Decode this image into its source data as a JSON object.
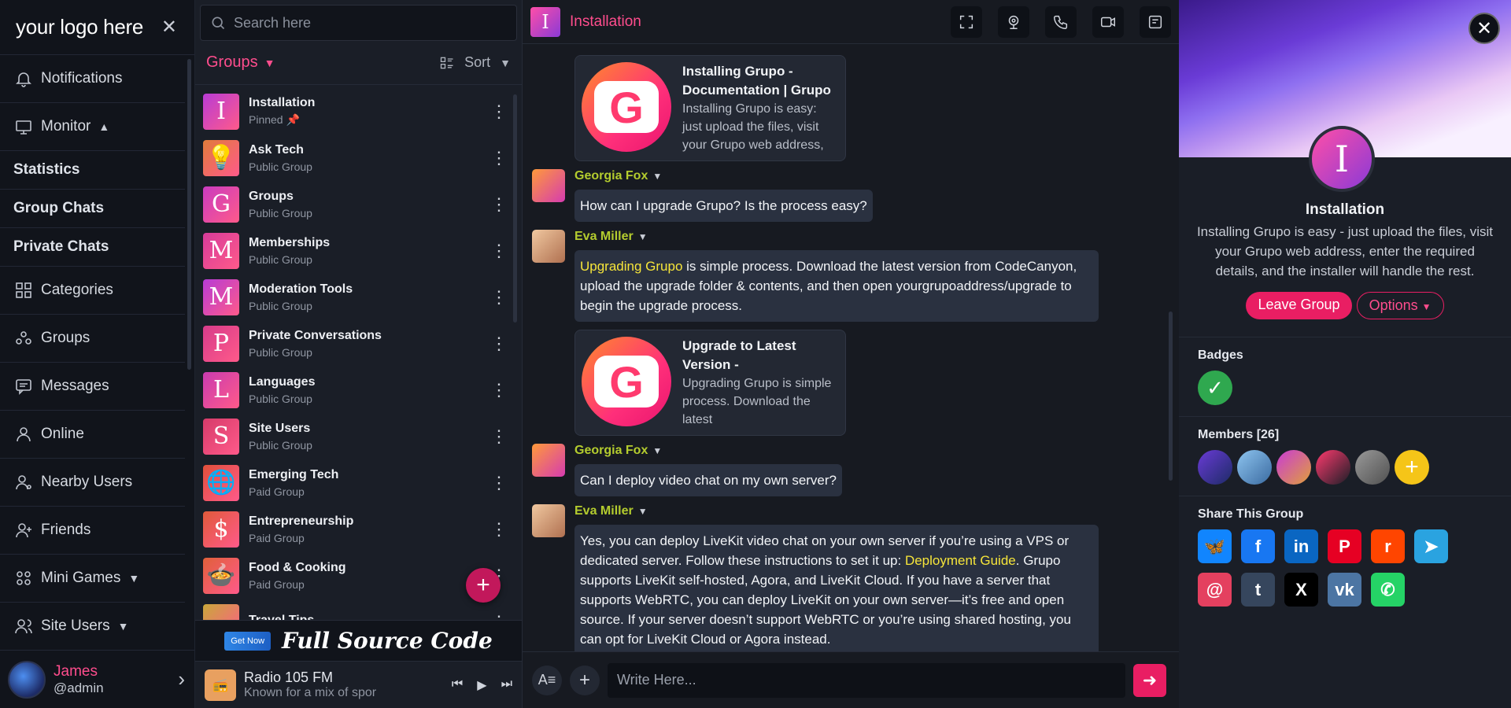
{
  "nav": {
    "logo": "your logo here",
    "items": [
      {
        "label": "Notifications",
        "icon": "bell-icon",
        "type": "main"
      },
      {
        "label": "Monitor",
        "icon": "monitor-icon",
        "type": "main",
        "chevron": "up"
      },
      {
        "label": "Statistics",
        "type": "sub"
      },
      {
        "label": "Group Chats",
        "type": "sub"
      },
      {
        "label": "Private Chats",
        "type": "sub"
      },
      {
        "label": "Categories",
        "icon": "grid-icon",
        "type": "main"
      },
      {
        "label": "Groups",
        "icon": "groups-icon",
        "type": "main"
      },
      {
        "label": "Messages",
        "icon": "message-icon",
        "type": "main"
      },
      {
        "label": "Online",
        "icon": "user-icon",
        "type": "main"
      },
      {
        "label": "Nearby Users",
        "icon": "nearby-icon",
        "type": "main"
      },
      {
        "label": "Friends",
        "icon": "add-user-icon",
        "type": "main"
      },
      {
        "label": "Mini Games",
        "icon": "games-icon",
        "type": "main",
        "chevron": "down"
      },
      {
        "label": "Site Users",
        "icon": "users-icon",
        "type": "main",
        "chevron": "down"
      }
    ],
    "user": {
      "name": "James",
      "handle": "@admin"
    }
  },
  "grouplist": {
    "search_placeholder": "Search here",
    "title": "Groups",
    "sort": "Sort",
    "items": [
      {
        "name": "Installation",
        "sub": "Pinned",
        "letter": "I",
        "color": "#b83bd6",
        "pinned": true
      },
      {
        "name": "Ask Tech",
        "sub": "Public Group",
        "letter": "💡",
        "color": "#e07c3a"
      },
      {
        "name": "Groups",
        "sub": "Public Group",
        "letter": "G",
        "color": "#c93bc0"
      },
      {
        "name": "Memberships",
        "sub": "Public Group",
        "letter": "M",
        "color": "#d63b9a"
      },
      {
        "name": "Moderation Tools",
        "sub": "Public Group",
        "letter": "M",
        "color": "#b63bd6"
      },
      {
        "name": "Private Conversations",
        "sub": "Public Group",
        "letter": "P",
        "color": "#d63b8a"
      },
      {
        "name": "Languages",
        "sub": "Public Group",
        "letter": "L",
        "color": "#c93bb0"
      },
      {
        "name": "Site Users",
        "sub": "Public Group",
        "letter": "S",
        "color": "#d63b6a"
      },
      {
        "name": "Emerging Tech",
        "sub": "Paid Group",
        "letter": "🌐",
        "color": "#e0503a"
      },
      {
        "name": "Entrepreneurship",
        "sub": "Paid Group",
        "letter": "$",
        "color": "#e05a3a"
      },
      {
        "name": "Food & Cooking",
        "sub": "Paid Group",
        "letter": "🍲",
        "color": "#e0603a"
      },
      {
        "name": "Travel Tips",
        "sub": "",
        "letter": "",
        "color": "#c9a83a"
      }
    ],
    "ad": {
      "button": "Get Now",
      "text": "Full Source Code"
    },
    "radio": {
      "name": "Radio 105 FM",
      "desc": "Known for a mix of spor"
    }
  },
  "chat": {
    "title": "Installation",
    "card1": {
      "title": "Installing Grupo - Documentation | Grupo",
      "desc": "Installing Grupo is easy: just upload the files, visit your Grupo web address,"
    },
    "msg1": {
      "author": "Georgia Fox",
      "text": "How can I upgrade Grupo? Is the process easy?"
    },
    "msg2": {
      "author": "Eva Miller",
      "link": "Upgrading Grupo",
      "text": " is simple process. Download the latest version from CodeCanyon, upload the upgrade folder & contents, and then open yourgrupoaddress/upgrade to begin the upgrade process."
    },
    "card2": {
      "title": "Upgrade to Latest Version -",
      "desc": "Upgrading Grupo is simple process. Download the latest"
    },
    "msg3": {
      "author": "Georgia Fox",
      "text": "Can I deploy video chat on my own server?"
    },
    "msg4": {
      "author": "Eva Miller",
      "text_a": "Yes, you can deploy LiveKit video chat on your own server if you’re using a VPS or dedicated server. Follow these instructions to set it up: ",
      "link": "Deployment Guide",
      "text_b": ". Grupo supports LiveKit self-hosted, Agora, and LiveKit Cloud. If you have a server that supports WebRTC, you can deploy LiveKit on your own server—it’s free and open source. If your server doesn’t support WebRTC or you’re using shared hosting, you can opt for LiveKit Cloud or Agora instead."
    },
    "composer_placeholder": "Write Here..."
  },
  "info": {
    "title": "Installation",
    "desc": "Installing Grupo is easy - just upload the files, visit your Grupo web address, enter the required details, and the installer will handle the rest.",
    "leave": "Leave Group",
    "options": "Options",
    "badges_title": "Badges",
    "members_title": "Members [26]",
    "share_title": "Share This Group",
    "share": [
      {
        "name": "bluesky",
        "color": "#1185fe",
        "glyph": "🦋"
      },
      {
        "name": "facebook",
        "color": "#1877f2",
        "glyph": "f"
      },
      {
        "name": "linkedin",
        "color": "#0a66c2",
        "glyph": "in"
      },
      {
        "name": "pinterest",
        "color": "#e60023",
        "glyph": "P"
      },
      {
        "name": "reddit",
        "color": "#ff4500",
        "glyph": "r"
      },
      {
        "name": "telegram",
        "color": "#2aa3e0",
        "glyph": "➤"
      },
      {
        "name": "threads",
        "color": "#e4405f",
        "glyph": "@"
      },
      {
        "name": "tumblr",
        "color": "#36465d",
        "glyph": "t"
      },
      {
        "name": "x",
        "color": "#000000",
        "glyph": "X"
      },
      {
        "name": "vk",
        "color": "#4c75a3",
        "glyph": "vk"
      },
      {
        "name": "whatsapp",
        "color": "#25d366",
        "glyph": "✆"
      }
    ]
  }
}
